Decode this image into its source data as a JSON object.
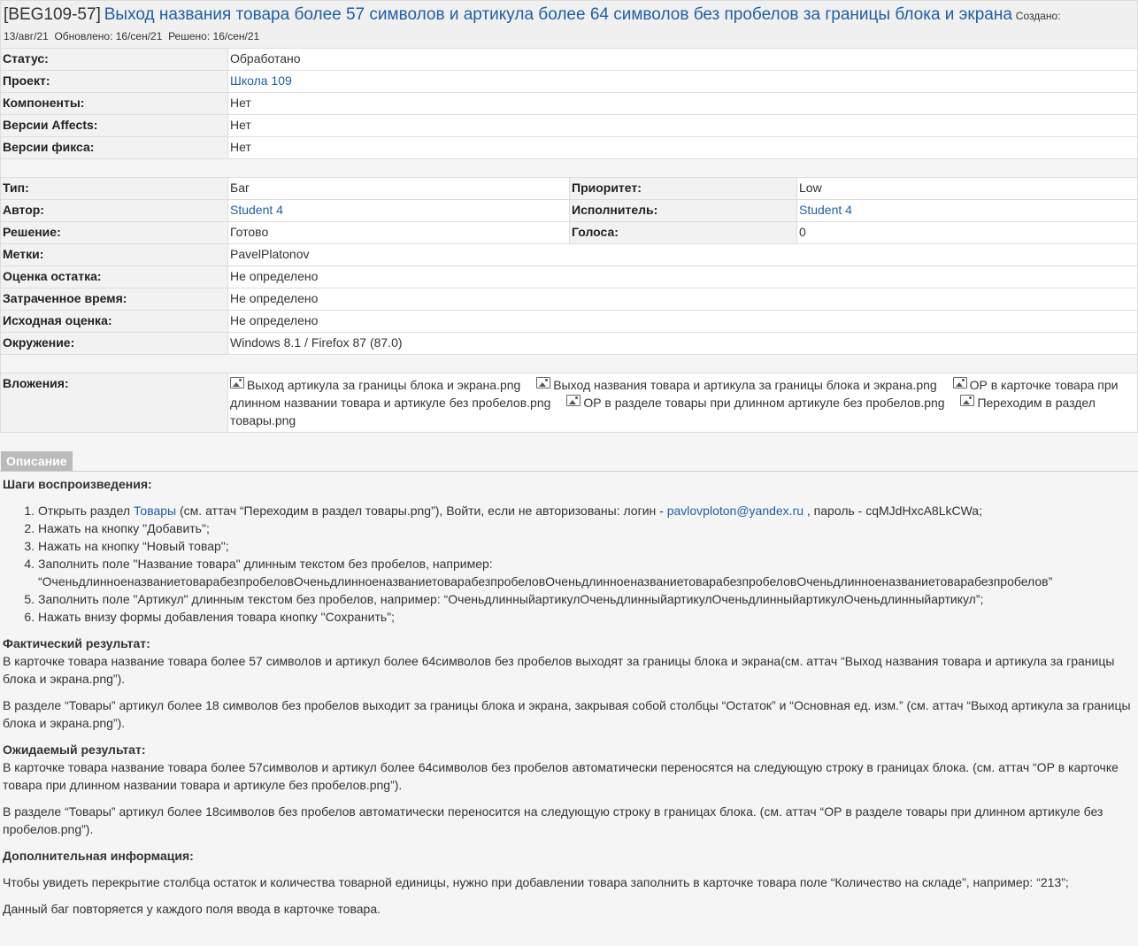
{
  "header": {
    "issue_key": "[BEG109-57]",
    "title": "Выход названия товара более 57 символов и артикула более 64 символов без пробелов за границы блока и экрана",
    "created_label": "Создано:",
    "created_value": "13/авг/21",
    "updated_label": "Обновлено:",
    "updated_value": "16/сен/21",
    "resolved_label": "Решено:",
    "resolved_value": "16/сен/21"
  },
  "fields1": [
    {
      "label": "Статус:",
      "value": "Обработано",
      "link": false
    },
    {
      "label": "Проект:",
      "value": "Школа 109",
      "link": true
    },
    {
      "label": "Компоненты:",
      "value": "Нет",
      "link": false
    },
    {
      "label": "Версии Affects:",
      "value": "Нет",
      "link": false
    },
    {
      "label": "Версии фикса:",
      "value": "Нет",
      "link": false
    }
  ],
  "fields2_pairs": [
    {
      "l1": "Тип:",
      "v1": "Баг",
      "l2": "Приоритет:",
      "v2": "Low"
    },
    {
      "l1": "Автор:",
      "v1": "Student 4",
      "l2": "Исполнитель:",
      "v2": "Student 4"
    },
    {
      "l1": "Решение:",
      "v1": "Готово",
      "l2": "Голоса:",
      "v2": "0"
    }
  ],
  "fields2_single": [
    {
      "label": "Метки:",
      "value": "PavelPlatonov"
    },
    {
      "label": "Оценка остатка:",
      "value": "Не определено"
    },
    {
      "label": "Затраченное время:",
      "value": "Не определено"
    },
    {
      "label": "Исходная оценка:",
      "value": "Не определено"
    },
    {
      "label": "Окружение:",
      "value": "Windows 8.1 / Firefox 87 (87.0)"
    }
  ],
  "attachments": {
    "label": "Вложения:",
    "items": [
      "Выход артикула за границы блока и экрана.png",
      "Выход названия товара и артикула за границы блока и экрана.png",
      "ОР в карточке товара при длинном названии товара и артикуле без пробелов.png",
      "ОР в разделе товары при длинном артикуле без пробелов.png",
      "Переходим в раздел товары.png"
    ]
  },
  "description": {
    "tab_label": "Описание",
    "steps_title": "Шаги воспроизведения:",
    "step1_pre": "Открыть раздел ",
    "step1_link": "Товары",
    "step1_mid": " (см. аттач “Переходим в раздел товары.png”), Войти, если не авторизованы: логин - ",
    "step1_email": "pavlovploton@yandex.ru",
    "step1_post": " , пароль - cqMJdHxcA8LkCWa;",
    "steps": [
      "Нажать на кнопку \"Добавить\";",
      "Нажать на кнопку “Новый товар\";",
      "Заполнить поле \"Название товара\" длинным текстом без пробелов, например: “ОченьдлинноеназваниетоварабезпробеловОченьдлинноеназваниетоварабезпробеловОченьдлинноеназваниетоварабезпробеловОченьдлинноеназваниетоварабезпробелов”",
      "Заполнить поле \"Артикул\" длинным текстом без пробелов, например: “ОченьдлинныйартикулОченьдлинныйартикулОченьдлинныйартикулОченьдлинныйартикул”;",
      "Нажать внизу формы добавления товара кнопку \"Сохранить\";"
    ],
    "actual_title": "Фактический результат:",
    "actual_p1": "В карточке товара название товара более 57 символов и артикул более 64символов без пробелов выходят за границы блока и экрана(см. аттач “Выход названия товара и артикула за границы блока и экрана.png”).",
    "actual_p2": "В разделе “Товары” артикул более 18 символов без пробелов выходит за границы блока и экрана, закрывая собой столбцы “Остаток” и “Основная ед. изм.” (см. аттач “Выход артикула за границы блока и экрана.png”).",
    "expected_title": "Ожидаемый результат:",
    "expected_p1": "В карточке товара название товара более 57символов и артикул более 64символов без пробелов автоматически переносятся на следующую строку в границах блока. (см. аттач “ОР в карточке товара при длинном названии товара и артикуле без пробелов.png”).",
    "expected_p2": "В разделе “Товары” артикул более 18символов без пробелов автоматически переносится на следующую строку в границах блока. (см. аттач “ОР в разделе товары при длинном артикуле без пробелов.png”).",
    "extra_title": "Дополнительная информация:",
    "extra_p1": "Чтобы увидеть перекрытие столбца остаток и количества товарной единицы, нужно при добавлении товара заполнить в карточке товара поле “Количество на складе”, например: “213”;",
    "extra_p2": "Данный баг повторяется у каждого поля ввода в карточке товара."
  }
}
